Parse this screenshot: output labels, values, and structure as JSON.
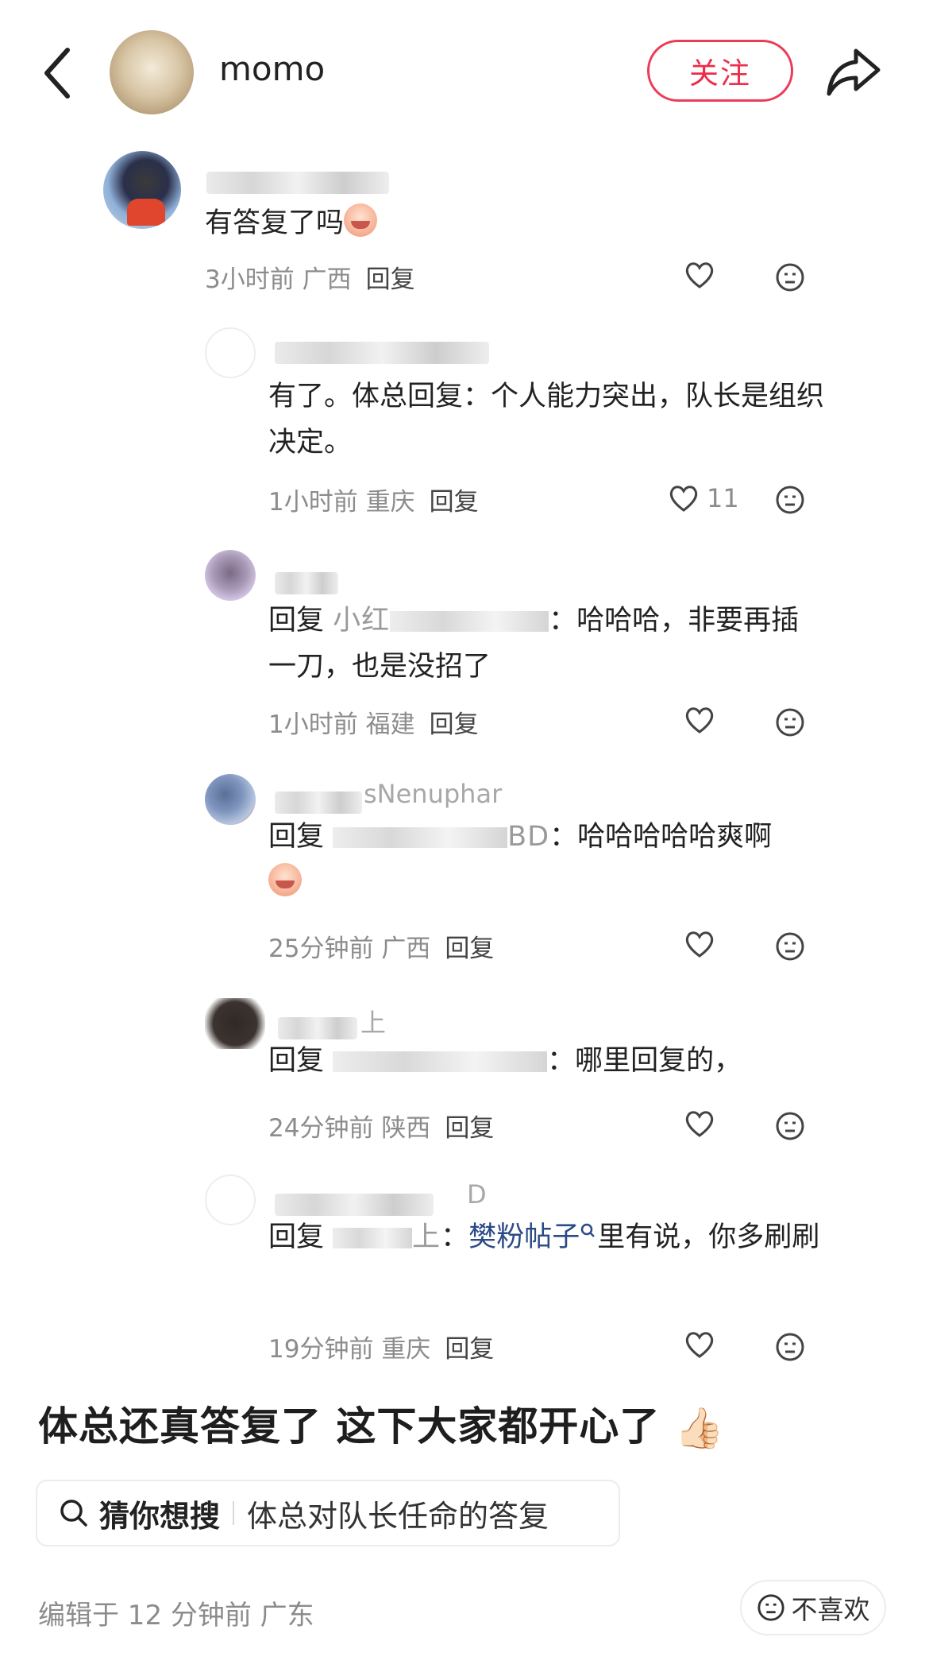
{
  "header": {
    "author_name": "momo",
    "follow_label": "关注"
  },
  "comments": [
    {
      "text": "有答复了吗",
      "time": "3小时前",
      "location": "广西",
      "reply_label": "回复",
      "likes": ""
    },
    {
      "text": "有了。体总回复：个人能力突出，队长是组织决定。",
      "time": "1小时前",
      "location": "重庆",
      "reply_label": "回复",
      "likes": "11"
    },
    {
      "reply_prefix": "回复",
      "reply_target": "小红",
      "text": "：哈哈哈，非要再插一刀，也是没招了",
      "time": "1小时前",
      "location": "福建",
      "reply_label": "回复",
      "likes": ""
    },
    {
      "username_tail": "sNenuphar",
      "reply_prefix": "回复",
      "reply_target": "BD",
      "text": "：哈哈哈哈哈爽啊",
      "time": "25分钟前",
      "location": "广西",
      "reply_label": "回复",
      "likes": ""
    },
    {
      "username_tail": "上",
      "reply_prefix": "回复",
      "reply_target": "",
      "text": "：哪里回复的，",
      "time": "24分钟前",
      "location": "陕西",
      "reply_label": "回复",
      "likes": ""
    },
    {
      "username_tail": "D",
      "reply_prefix": "回复",
      "reply_target": "上",
      "text_before_link": "：",
      "link_text": "樊粉帖子",
      "text_after_link": "里有说，你多刷刷",
      "time": "19分钟前",
      "location": "重庆",
      "reply_label": "回复",
      "likes": ""
    }
  ],
  "post": {
    "text": "体总还真答复了 这下大家都开心了",
    "emoji": "👍🏻"
  },
  "search_suggestion": {
    "label": "猜你想搜",
    "query": "体总对队长任命的答复"
  },
  "footer": {
    "edited_text": "编辑于 12 分钟前 广东",
    "not_like_label": "不喜欢"
  },
  "colors": {
    "accent": "#ee2d4a",
    "link": "#2b4a86",
    "meta": "#8c8c8c"
  }
}
